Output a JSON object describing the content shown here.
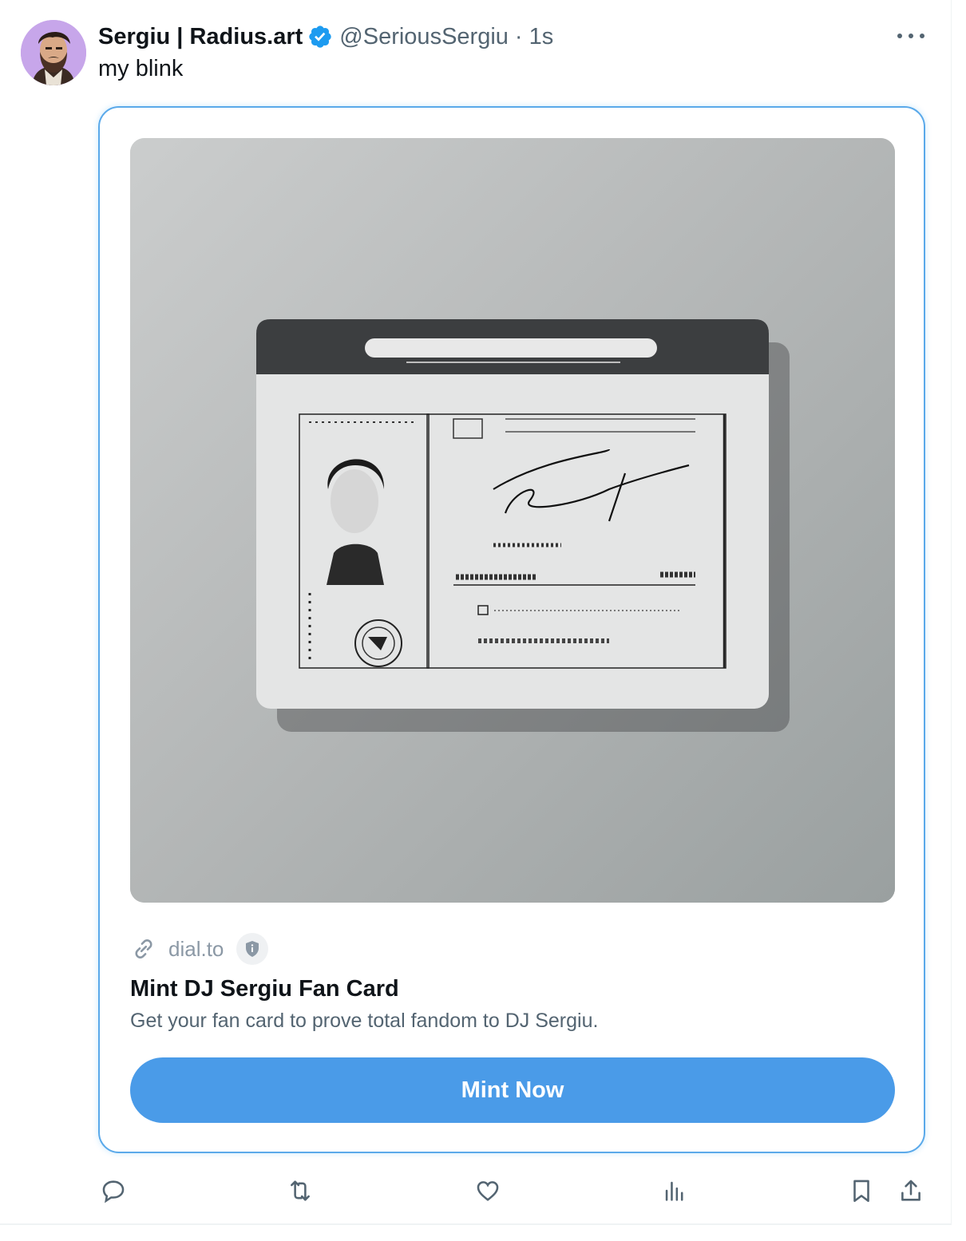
{
  "tweet": {
    "author": {
      "display_name": "Sergiu | Radius.art",
      "handle": "@SeriousSergiu",
      "time": "1s",
      "separator": "·",
      "verified": true,
      "avatar_icon": "bearded-man-avatar"
    },
    "text": "my blink"
  },
  "card": {
    "image_icon": "id-card-illustration",
    "link_icon": "link-icon",
    "domain": "dial.to",
    "badge_icon": "shield-info-icon",
    "title": "Mint DJ Sergiu Fan Card",
    "description": "Get your fan card to prove total fandom to DJ Sergiu.",
    "button_label": "Mint Now"
  },
  "actions": [
    "reply-icon",
    "retweet-icon",
    "like-icon",
    "views-icon",
    "bookmark-icon",
    "share-icon"
  ],
  "colors": {
    "accent": "#4a9be8",
    "card_border": "#5aa9ea",
    "verified": "#1d9bf0",
    "secondary_text": "#536471",
    "avatar_bg": "#c7a6ea"
  }
}
